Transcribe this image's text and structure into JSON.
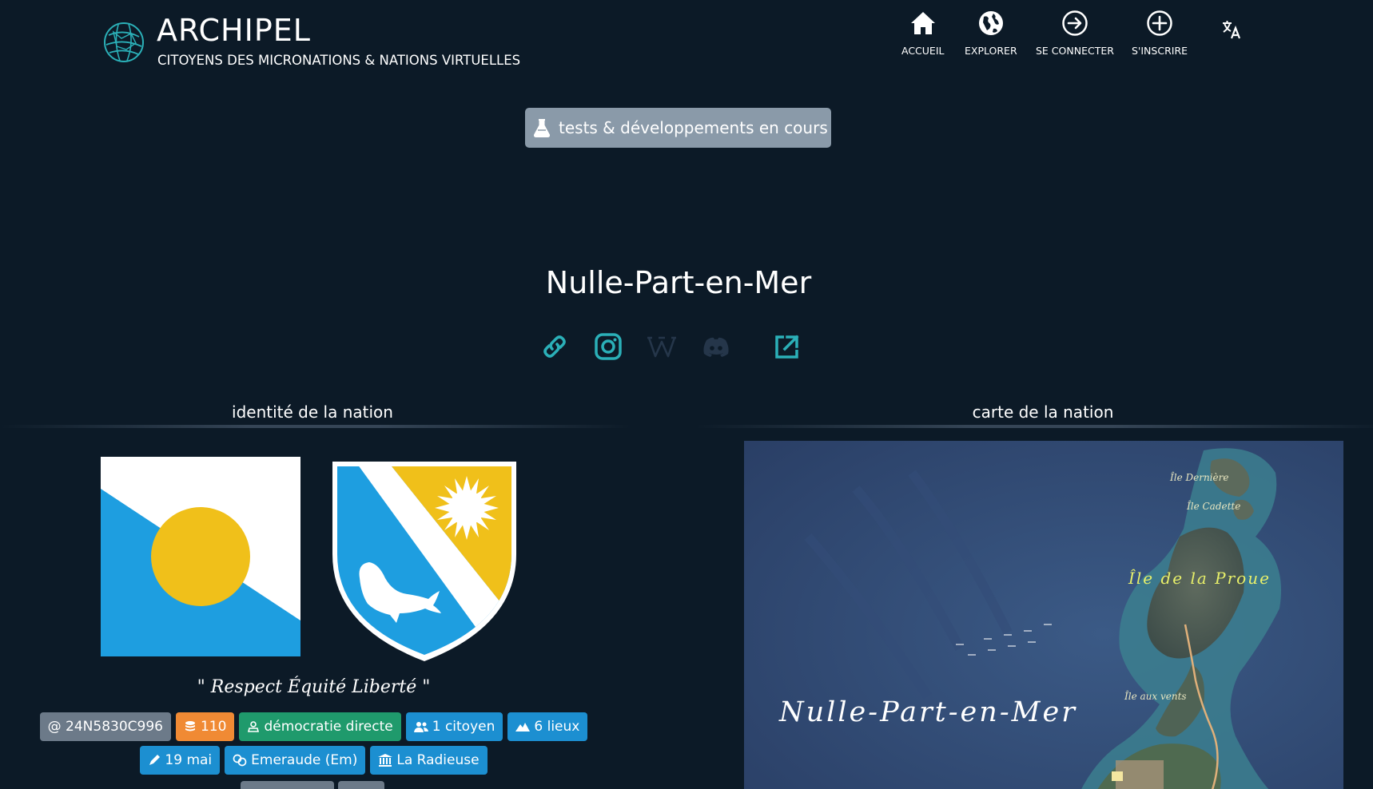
{
  "header": {
    "title": "ARCHIPEL",
    "subtitle": "CITOYENS DES MICRONATIONS & NATIONS VIRTUELLES",
    "nav": [
      {
        "label": "ACCUEIL",
        "icon": "home-icon"
      },
      {
        "label": "EXPLORER",
        "icon": "globe-icon"
      },
      {
        "label": "SE CONNECTER",
        "icon": "login-icon"
      },
      {
        "label": "S'INSCRIRE",
        "icon": "plus-circle-icon"
      }
    ],
    "language_icon": "translate-icon"
  },
  "dev_notice": {
    "label": "tests & développements en cours",
    "icon": "flask-icon"
  },
  "nation": {
    "name": "Nulle-Part-en-Mer",
    "socials": [
      "link-icon",
      "instagram-icon",
      "wikipedia-icon",
      "discord-icon",
      "external-link-icon"
    ]
  },
  "identity": {
    "title": "identité de la nation",
    "motto": "\" Respect Équité Liberté \"",
    "badges_row1": [
      {
        "label": "@ 24N5830C996",
        "color": "grey"
      },
      {
        "label": "110",
        "color": "orange",
        "icon": "coins-icon"
      },
      {
        "label": "démocratie directe",
        "color": "green",
        "icon": "vote-icon"
      },
      {
        "label": "1 citoyen",
        "color": "blue",
        "icon": "users-icon"
      },
      {
        "label": "6 lieux",
        "color": "blue",
        "icon": "mountain-icon"
      }
    ],
    "badges_row2": [
      {
        "label": "19 mai",
        "color": "blue",
        "icon": "pen-icon"
      },
      {
        "label": "Emeraude (Em)",
        "color": "blue",
        "icon": "currency-icon"
      },
      {
        "label": "La Radieuse",
        "color": "blue",
        "icon": "institution-icon"
      }
    ]
  },
  "map": {
    "title": "carte de la nation",
    "labels": {
      "nation": "Nulle-Part-en-Mer",
      "ile_derniere": "Île Dernière",
      "ile_cadette": "Île Cadette",
      "ile_proue": "Île de la Proue",
      "ile_vents": "Île aux vents"
    }
  },
  "colors": {
    "background": "#0c1a27",
    "accent_teal": "#2bb0b8",
    "flag_blue": "#1e9ee0",
    "flag_yellow": "#f0c01a",
    "badge_grey": "#6c7a89",
    "badge_orange": "#f08a34",
    "badge_green": "#1f9a6c",
    "badge_blue": "#1c8fd1"
  }
}
